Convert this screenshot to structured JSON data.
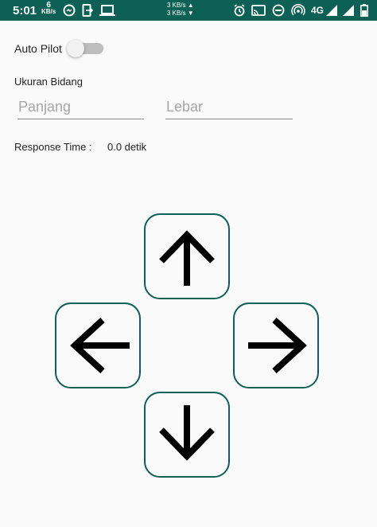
{
  "status_bar": {
    "time": "5:01",
    "speed_value": "6",
    "speed_unit": "KB/s",
    "network_up": "3 KB/s ▲",
    "network_down": "3 KB/s ▼",
    "network_type": "4G",
    "background_color": "#0d6154"
  },
  "auto_pilot": {
    "label": "Auto Pilot",
    "enabled": false
  },
  "field_size": {
    "label": "Ukuran Bidang",
    "length_placeholder": "Panjang",
    "width_placeholder": "Lebar",
    "length_value": "",
    "width_value": ""
  },
  "response_time": {
    "label": "Response Time :",
    "value": "0.0 detik"
  },
  "controls": {
    "up": "arrow-up-icon",
    "left": "arrow-left-icon",
    "right": "arrow-right-icon",
    "down": "arrow-down-icon",
    "border_color": "#0d6154"
  }
}
